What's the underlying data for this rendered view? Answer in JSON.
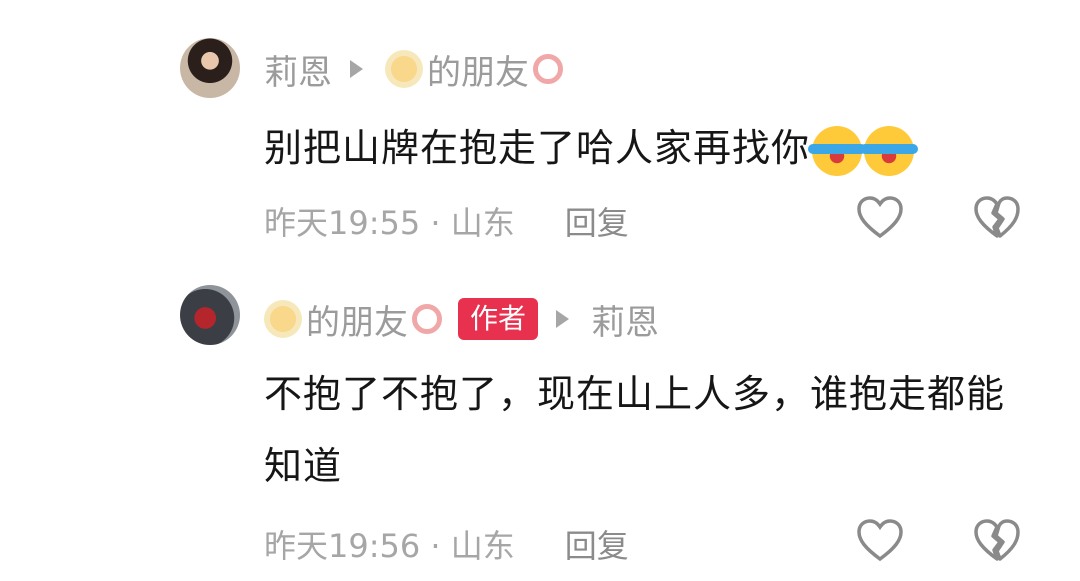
{
  "comments": [
    {
      "author": "莉恩",
      "reply_to": "的朋友",
      "text": "别把山牌在抱走了哈人家再找你",
      "emoji": [
        "laugh-cry-icon",
        "laugh-cry-icon"
      ],
      "time_location": "昨天19:55 · 山东",
      "reply_label": "回复"
    },
    {
      "author": "的朋友",
      "author_badge": "作者",
      "reply_to": "莉恩",
      "text": "不抱了不抱了，现在山上人多，谁抱走都能知道",
      "time_location": "昨天19:56 · 山东",
      "reply_label": "回复"
    }
  ],
  "colors": {
    "badge": "#e8304f",
    "meta_text": "#a6a6a6",
    "body_text": "#161616"
  }
}
